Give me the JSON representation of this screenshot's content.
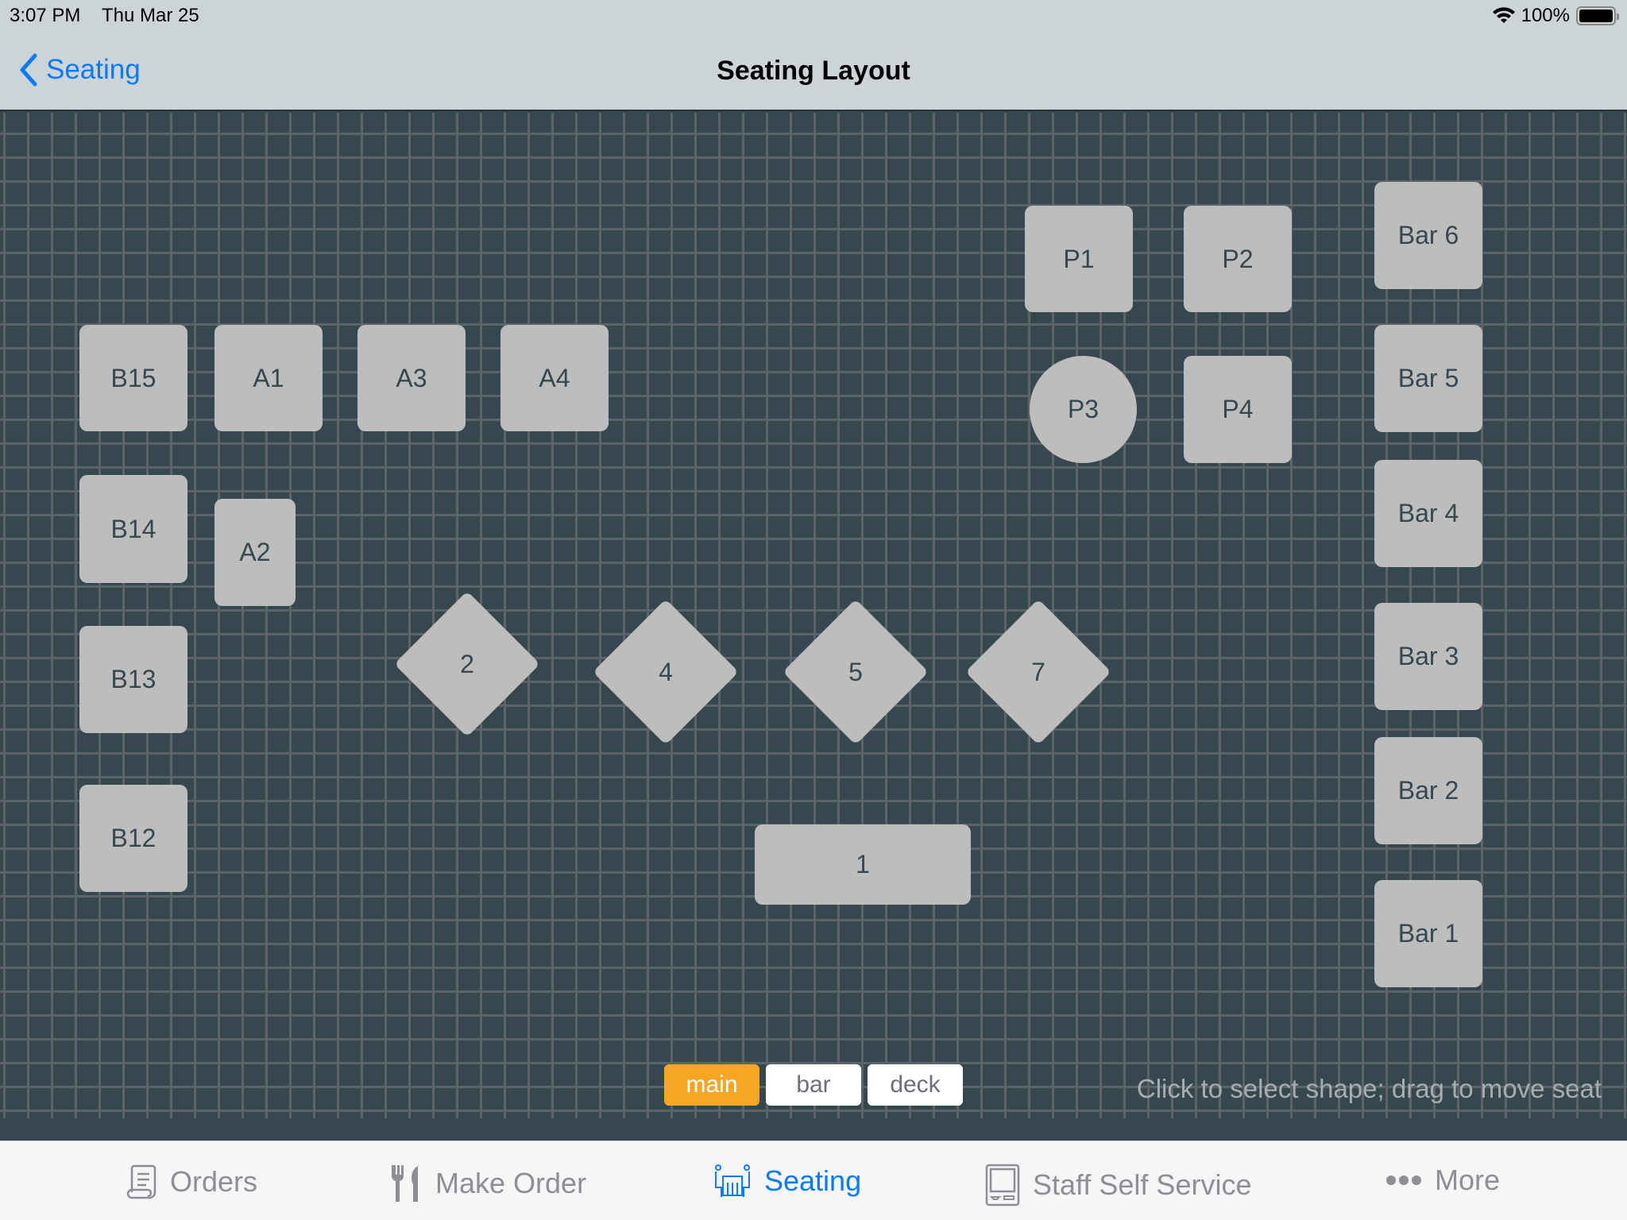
{
  "status_bar": {
    "time": "3:07 PM",
    "date": "Thu Mar 25",
    "battery_percent": "100%",
    "battery_level": 1.0,
    "wifi_icon": "wifi-icon",
    "battery_icon": "battery-icon"
  },
  "nav": {
    "back_label": "Seating",
    "back_icon": "chevron-left-icon",
    "title": "Seating Layout"
  },
  "tables": [
    {
      "label": "B15",
      "shape": "square"
    },
    {
      "label": "A1",
      "shape": "square"
    },
    {
      "label": "A3",
      "shape": "square"
    },
    {
      "label": "A4",
      "shape": "square"
    },
    {
      "label": "B14",
      "shape": "square"
    },
    {
      "label": "A2",
      "shape": "rectangle"
    },
    {
      "label": "B13",
      "shape": "square"
    },
    {
      "label": "B12",
      "shape": "square"
    },
    {
      "label": "P1",
      "shape": "square"
    },
    {
      "label": "P2",
      "shape": "square"
    },
    {
      "label": "P3",
      "shape": "circle"
    },
    {
      "label": "P4",
      "shape": "square"
    },
    {
      "label": "Bar 6",
      "shape": "square"
    },
    {
      "label": "Bar 5",
      "shape": "square"
    },
    {
      "label": "Bar 4",
      "shape": "square"
    },
    {
      "label": "Bar 3",
      "shape": "square"
    },
    {
      "label": "Bar 2",
      "shape": "square"
    },
    {
      "label": "Bar 1",
      "shape": "square"
    },
    {
      "label": "2",
      "shape": "diamond"
    },
    {
      "label": "4",
      "shape": "diamond"
    },
    {
      "label": "5",
      "shape": "diamond"
    },
    {
      "label": "7",
      "shape": "diamond"
    },
    {
      "label": "1",
      "shape": "rectangle"
    }
  ],
  "sections": {
    "items": [
      {
        "label": "main",
        "active": true
      },
      {
        "label": "bar",
        "active": false
      },
      {
        "label": "deck",
        "active": false
      }
    ]
  },
  "hint": "Click to select shape; drag to move seat",
  "colors": {
    "accent_blue": "#0a7aff",
    "active_section": "#f6a623",
    "table_fill": "#bdbdbd",
    "canvas_bg": "#37474f"
  },
  "tabbar": {
    "items": [
      {
        "label": "Orders",
        "icon": "receipt-icon",
        "active": false
      },
      {
        "label": "Make Order",
        "icon": "fork-knife-icon",
        "active": false
      },
      {
        "label": "Seating",
        "icon": "seating-icon",
        "active": true
      },
      {
        "label": "Staff Self Service",
        "icon": "kiosk-icon",
        "active": false
      },
      {
        "label": "More",
        "icon": "more-dots-icon",
        "active": false
      }
    ]
  }
}
